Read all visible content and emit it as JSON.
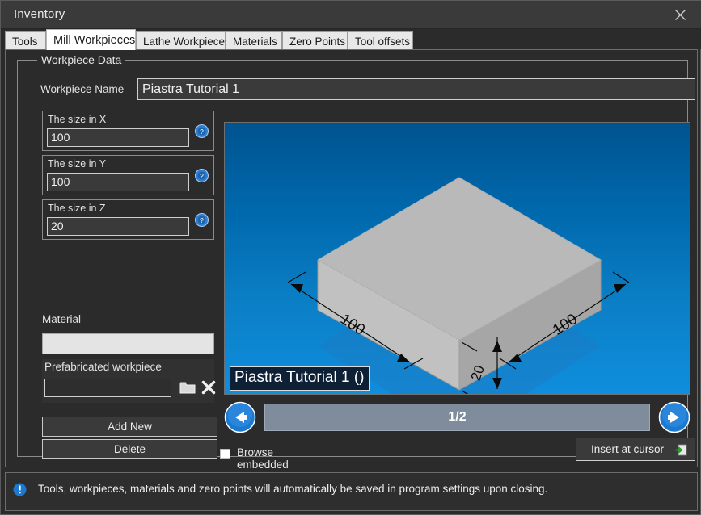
{
  "window": {
    "title": "Inventory",
    "close_icon": "close-icon"
  },
  "tabs": [
    {
      "label": "Tools",
      "active": false
    },
    {
      "label": "Mill Workpieces",
      "active": true
    },
    {
      "label": "Lathe Workpieces",
      "active": false
    },
    {
      "label": "Materials",
      "active": false
    },
    {
      "label": "Zero Points",
      "active": false
    },
    {
      "label": "Tool offsets",
      "active": false
    }
  ],
  "group": {
    "title": "Workpiece Data"
  },
  "form": {
    "workpiece_name_label": "Workpiece Name",
    "workpiece_name_value": "Piastra Tutorial 1",
    "sizes": [
      {
        "caption": "The size in X",
        "value": "100",
        "help_icon": "help-icon"
      },
      {
        "caption": "The size in Y",
        "value": "100",
        "help_icon": "help-icon"
      },
      {
        "caption": "The size in Z",
        "value": "20",
        "help_icon": "help-icon"
      }
    ],
    "material_label": "Material",
    "material_value": "",
    "prefab_label": "Prefabricated workpiece",
    "prefab_value": "",
    "prefab_browse_icon": "folder-icon",
    "prefab_clear_icon": "close-x-icon",
    "add_new_label": "Add New",
    "delete_label": "Delete"
  },
  "preview": {
    "caption": "Piastra Tutorial 1 ()",
    "dimensions": {
      "left": "100",
      "right": "100",
      "height": "20"
    },
    "colors": {
      "background_top": "#00538f",
      "background_bottom": "#0f8edd",
      "solid_top": "#b6b6b6",
      "solid_left": "#c2c2c2",
      "solid_right": "#a3a3a3"
    }
  },
  "navigation": {
    "prev_icon": "arrow-left-icon",
    "next_icon": "arrow-right-icon",
    "page_indicator": "1/2"
  },
  "bottom": {
    "browse_embedded_label": "Browse embedded",
    "browse_embedded_checked": false,
    "insert_label": "Insert at cursor",
    "insert_icon": "insert-document-icon"
  },
  "status": {
    "icon": "info-icon",
    "message": "Tools, workpieces, materials and zero points will automatically be saved in program settings upon closing."
  }
}
